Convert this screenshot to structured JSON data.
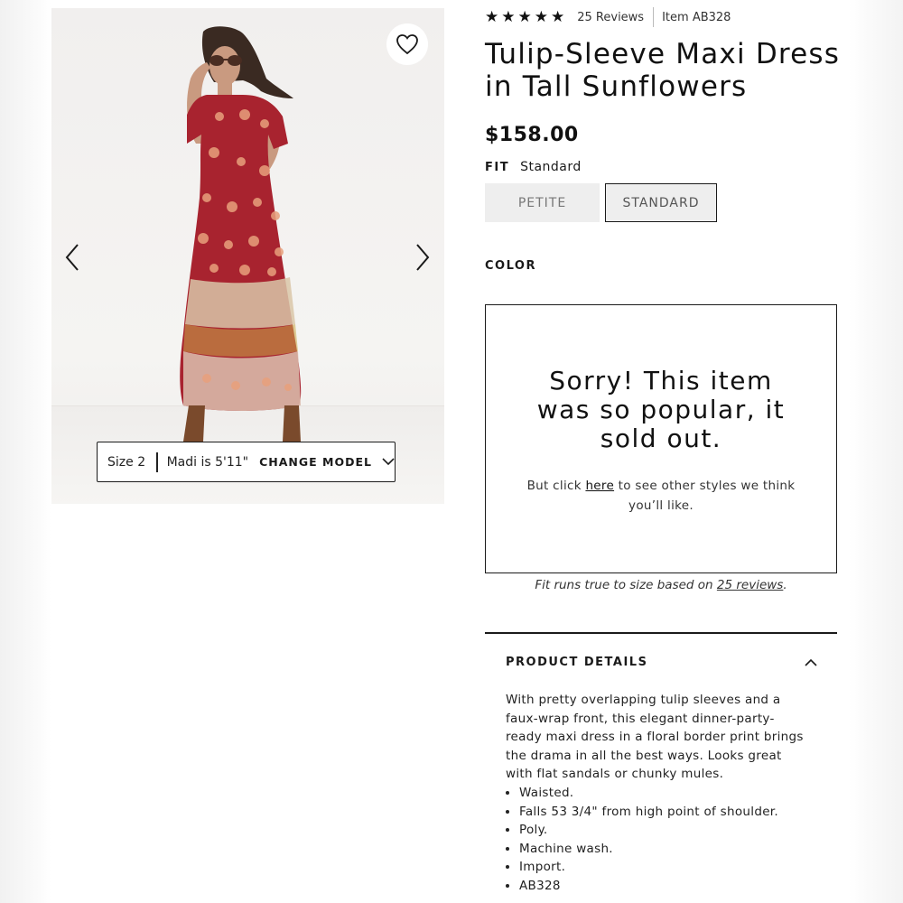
{
  "rating": {
    "stars": 5,
    "reviews_label": "25 Reviews",
    "item_label": "Item AB328"
  },
  "product": {
    "title": "Tulip-Sleeve Maxi Dress in Tall Sunflowers",
    "price": "$158.00"
  },
  "fit": {
    "label": "FIT",
    "selected_value": "Standard",
    "options": [
      "PETITE",
      "STANDARD"
    ]
  },
  "color": {
    "label": "COLOR"
  },
  "sold_out": {
    "heading": "Sorry! This item was so popular, it sold out.",
    "sub_before": "But click ",
    "sub_link": "here",
    "sub_after": " to see other styles we think you’ll like."
  },
  "fit_note": {
    "before": "Fit runs true to size based on ",
    "link": "25 reviews",
    "after": "."
  },
  "model_bar": {
    "size": "Size 2",
    "model_info": "Madi is 5'11\"",
    "change_label": "CHANGE MODEL"
  },
  "details": {
    "title": "PRODUCT DETAILS",
    "description": "With pretty overlapping tulip sleeves and a faux-wrap front, this elegant dinner-party-ready maxi dress in a floral border print brings the drama in all the best ways. Looks great with flat sandals or chunky mules.",
    "bullets": [
      "Waisted.",
      "Falls 53 3/4\" from high point of shoulder.",
      "Poly.",
      "Machine wash.",
      "Import.",
      "AB328"
    ]
  },
  "colors": {
    "dress_red": "#a8232f",
    "flower_peach": "#e8a07c",
    "text": "#1a1a1a"
  },
  "icons": {
    "wishlist": "heart-outline-icon",
    "prev": "chevron-left-icon",
    "next": "chevron-right-icon",
    "expand": "chevron-down-icon",
    "collapse": "chevron-up-icon",
    "star": "star-icon"
  }
}
